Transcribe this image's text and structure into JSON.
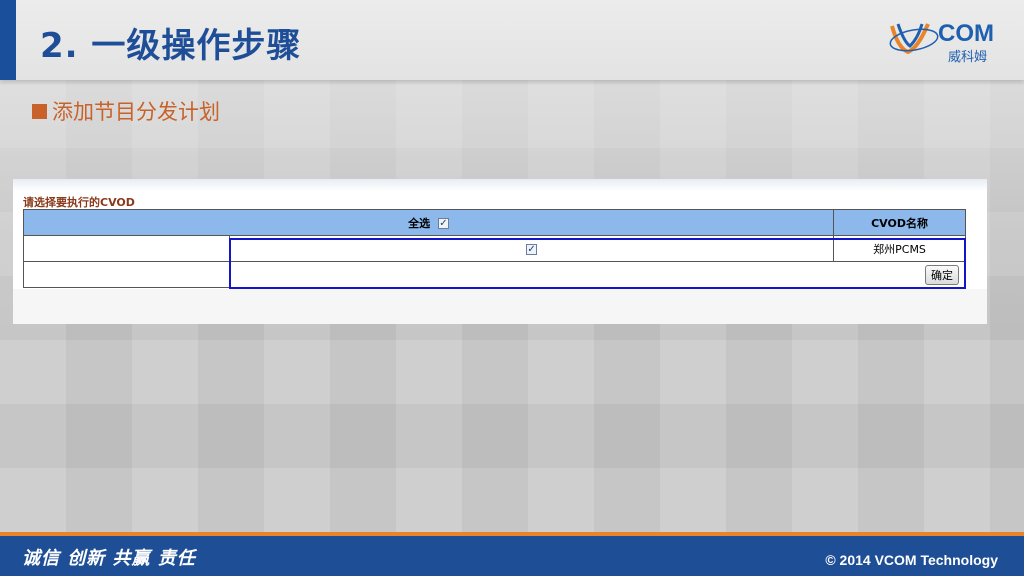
{
  "header": {
    "title": "2. 一级操作步骤",
    "logo_text": "COM",
    "logo_sub": "威科姆"
  },
  "section": {
    "title": "添加节目分发计划"
  },
  "panel": {
    "caption": "请选择要执行的CVOD",
    "columns": {
      "select_all": "全选",
      "name": "CVOD名称"
    },
    "rows": [
      {
        "checked": true,
        "name": "郑州PCMS"
      }
    ],
    "confirm_label": "确定"
  },
  "footer": {
    "slogan": "诚信 创新 共赢 责任",
    "copyright": "© 2014 VCOM Technology"
  },
  "colors": {
    "brand_blue": "#1f4e98",
    "accent_orange": "#c8622a",
    "table_header": "#8cb8ec",
    "highlight": "#1414c8"
  }
}
